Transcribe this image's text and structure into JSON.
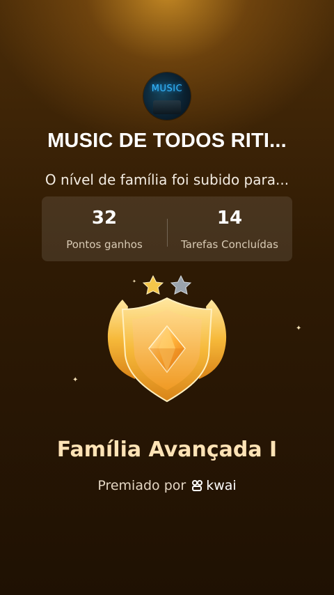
{
  "group": {
    "avatar_text": "MUSIC",
    "name": "MUSIC DE TODOS RITI..."
  },
  "message": "O nível de família foi subido para...",
  "stats": [
    {
      "value": "32",
      "label": "Pontos ganhos"
    },
    {
      "value": "14",
      "label": "Tarefas Concluídas"
    }
  ],
  "badge": {
    "stars_total": 2,
    "stars_filled": 1,
    "icon": "shield-crystal-icon"
  },
  "level": {
    "name": "Família Avançada I"
  },
  "award": {
    "prefix": "Premiado por",
    "brand": "kwai",
    "brand_icon": "kwai-logo-icon"
  },
  "colors": {
    "gold_star": "#f4c64a",
    "silver_star": "#9aa3ad",
    "level_text": "#ffe3b6"
  }
}
